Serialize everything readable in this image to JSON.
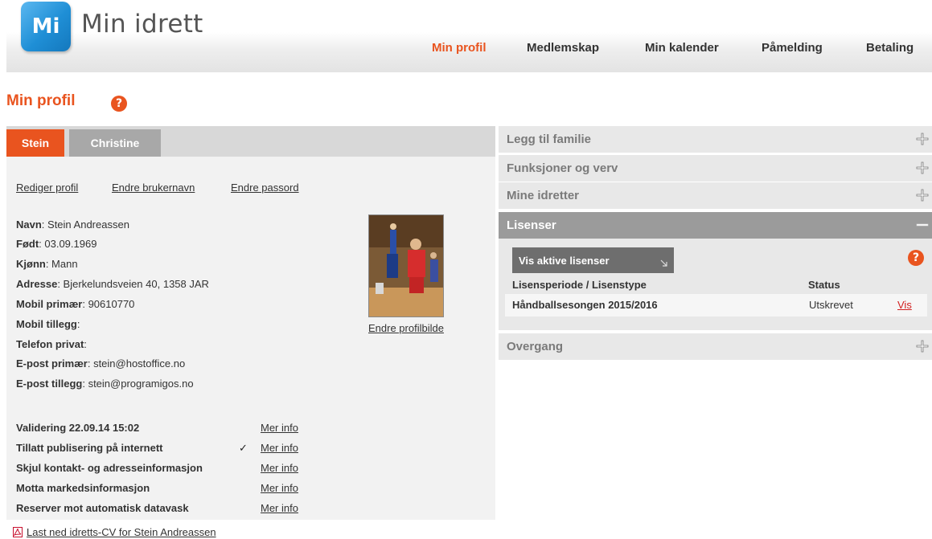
{
  "header": {
    "logo_mark": "Mi",
    "app_title": "Min idrett",
    "nav": [
      "Min profil",
      "Medlemskap",
      "Min kalender",
      "Påmelding",
      "Betaling"
    ]
  },
  "page": {
    "title": "Min profil",
    "help": "?"
  },
  "tabs": [
    "Stein",
    "Christine"
  ],
  "profile_links": {
    "edit_profile": "Rediger profil",
    "change_username": "Endre brukernavn",
    "change_password": "Endre passord"
  },
  "profile": [
    {
      "label": "Navn",
      "value": ": Stein Andreassen"
    },
    {
      "label": "Født",
      "value": ": 03.09.1969"
    },
    {
      "label": "Kjønn",
      "value": ": Mann"
    },
    {
      "label": "Adresse",
      "value": ": Bjerkelundsveien 40, 1358 JAR"
    },
    {
      "label": "Mobil primær",
      "value": ": 90610770"
    },
    {
      "label": "Mobil tillegg",
      "value": ":"
    },
    {
      "label": "Telefon privat",
      "value": ":"
    },
    {
      "label": "E-post primær",
      "value": ": stein@hostoffice.no"
    },
    {
      "label": "E-post tillegg",
      "value": ": stein@programigos.no"
    }
  ],
  "photo_link": "Endre profilbilde",
  "preferences": [
    {
      "label": "Validering 22.09.14 15:02",
      "checked": false,
      "link": "Mer info"
    },
    {
      "label": "Tillatt publisering på internett",
      "checked": true,
      "link": "Mer info"
    },
    {
      "label": "Skjul kontakt- og adresseinformasjon",
      "checked": false,
      "link": "Mer info"
    },
    {
      "label": "Motta markedsinformasjon",
      "checked": false,
      "link": "Mer info"
    },
    {
      "label": "Reserver mot automatisk datavask",
      "checked": false,
      "link": "Mer info"
    }
  ],
  "check_mark": "✓",
  "cv_link": "Last ned idretts-CV for Stein Andreassen",
  "accordion": [
    {
      "title": "Legg til familie",
      "open": false
    },
    {
      "title": "Funksjoner og verv",
      "open": false
    },
    {
      "title": "Mine idretter",
      "open": false
    },
    {
      "title": "Lisenser",
      "open": true
    },
    {
      "title": "Overgang",
      "open": false
    }
  ],
  "licenses": {
    "button": "Vis aktive lisenser",
    "col_period": "Lisensperiode / Lisenstype",
    "col_status": "Status",
    "rows": [
      {
        "period": "Håndballsesongen 2015/2016",
        "status": "Utskrevet",
        "action": "Vis"
      }
    ]
  },
  "colors": {
    "accent": "#e9541f",
    "logo": "#1f8fd6",
    "link_red": "#d21f1f"
  }
}
